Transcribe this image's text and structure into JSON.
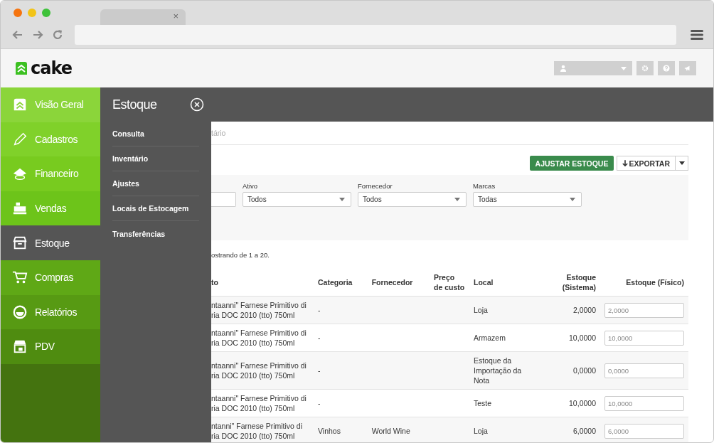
{
  "browser": {
    "tab_close": "×"
  },
  "header": {
    "logo": "cake"
  },
  "sidebar": {
    "items": [
      {
        "label": "Visão Geral",
        "selected": false
      },
      {
        "label": "Cadastros",
        "selected": false
      },
      {
        "label": "Financeiro",
        "selected": false
      },
      {
        "label": "Vendas",
        "selected": false
      },
      {
        "label": "Estoque",
        "selected": true
      },
      {
        "label": "Compras",
        "selected": false
      },
      {
        "label": "Relatórios",
        "selected": false
      },
      {
        "label": "PDV",
        "selected": false
      }
    ]
  },
  "flyout": {
    "title": "Estoque",
    "items": [
      "Consulta",
      "Inventário",
      "Ajustes",
      "Locais de Estocagem",
      "Transferências"
    ]
  },
  "breadcrumb": "tário",
  "actions": {
    "primary": "AJUSTAR ESTOQUE",
    "export": "EXPORTAR"
  },
  "filters": [
    {
      "label": "Ativo",
      "value": "Todos"
    },
    {
      "label": "Fornecedor",
      "value": "Todos"
    },
    {
      "label": "Marcas",
      "value": "Todas"
    }
  ],
  "summary": "ostrando de 1 a 20.",
  "table": {
    "columns": [
      "to",
      "Categoria",
      "Fornecedor",
      "Preço de custo",
      "Local",
      "Estoque (Sistema)",
      "Estoque (Físico)"
    ],
    "rows": [
      {
        "product": "ntaanni\" Farnese Primitivo di ria DOC 2010 (tto) 750ml",
        "category": "-",
        "supplier": "",
        "local": "Loja",
        "system": "2,0000",
        "physical": "2,0000"
      },
      {
        "product": "ntaanni\" Farnese Primitivo di ria DOC 2010 (tto) 750ml",
        "category": "-",
        "supplier": "",
        "local": "Armazem",
        "system": "10,0000",
        "physical": "10,0000"
      },
      {
        "product": "ntaanni\" Farnese Primitivo di ria DOC 2010 (tto) 750ml",
        "category": "-",
        "supplier": "",
        "local": "Estoque da Importação da Nota",
        "system": "0,0000",
        "physical": "0,0000"
      },
      {
        "product": "ntaanni\" Farnese Primitivo di ria DOC 2010 (tto) 750ml",
        "category": "-",
        "supplier": "",
        "local": "Teste",
        "system": "10,0000",
        "physical": "10,0000"
      },
      {
        "product": "ntanni\" Farnese Primitivo di ria DOC 2010 (tto) 750ml",
        "category": "Vinhos",
        "supplier": "World Wine",
        "local": "Loja",
        "system": "6,0000",
        "physical": "6,0000"
      }
    ]
  }
}
